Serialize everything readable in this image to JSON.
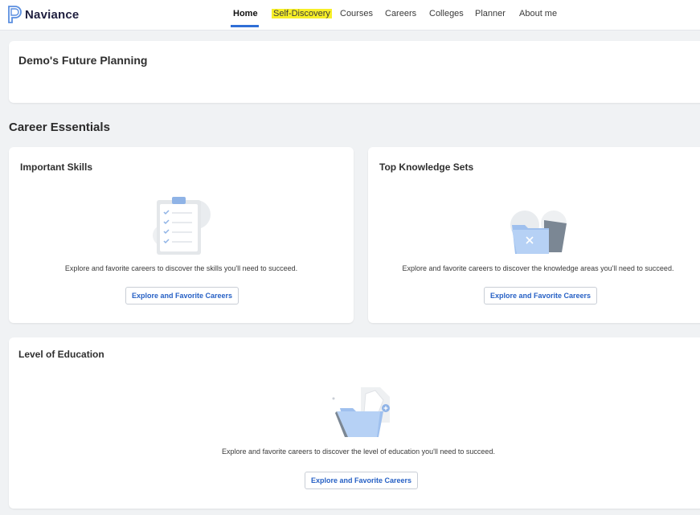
{
  "brand": {
    "name": "Naviance",
    "color": "#2f6fd6"
  },
  "nav": {
    "items": [
      {
        "label": "Home",
        "active": true
      },
      {
        "label": "Self-Discovery",
        "highlighted": true
      },
      {
        "label": "Courses"
      },
      {
        "label": "Careers"
      },
      {
        "label": "Colleges"
      },
      {
        "label": "Planner"
      },
      {
        "label": "About me"
      }
    ]
  },
  "future_planning": {
    "title": "Demo's Future Planning"
  },
  "career_essentials": {
    "title": "Career Essentials",
    "important_skills": {
      "title": "Important Skills",
      "description": "Explore and favorite careers to discover the skills you'll need to succeed.",
      "button": "Explore and Favorite Careers",
      "illustration": "clipboard-checklist-icon"
    },
    "top_knowledge_sets": {
      "title": "Top Knowledge Sets",
      "description": "Explore and favorite careers to discover the knowledge areas you'll need to succeed.",
      "button": "Explore and Favorite Careers",
      "illustration": "empty-folder-icon"
    },
    "level_of_education": {
      "title": "Level of Education",
      "description": "Explore and favorite careers to discover the level of education you'll need to succeed.",
      "button": "Explore and Favorite Careers",
      "illustration": "folder-with-documents-icon"
    }
  }
}
